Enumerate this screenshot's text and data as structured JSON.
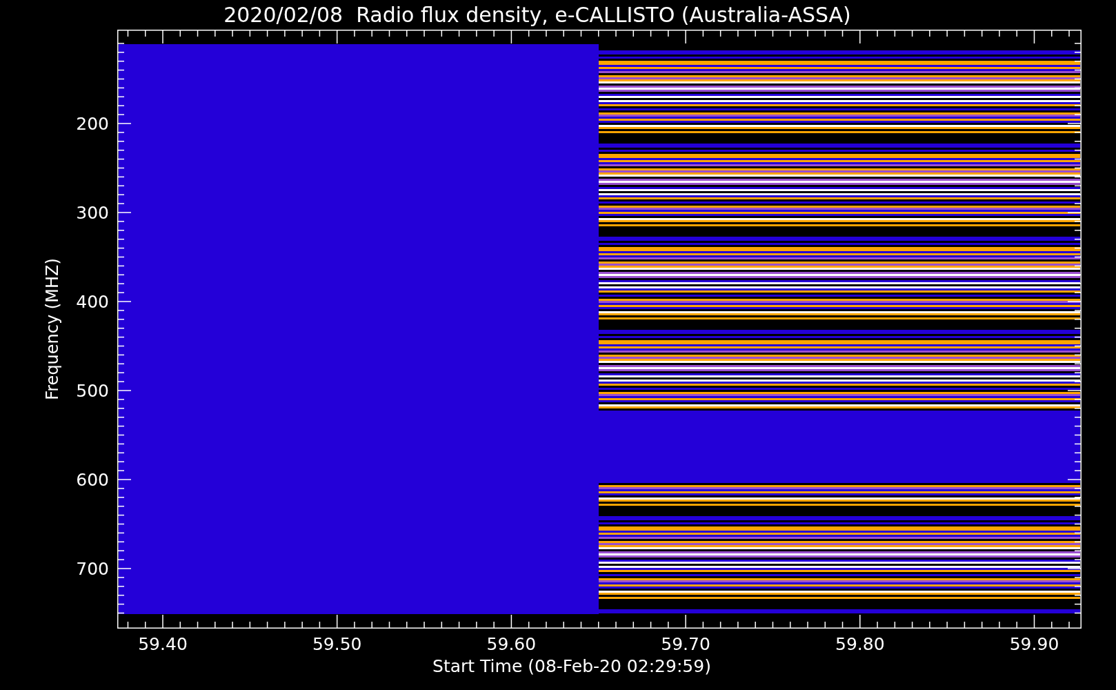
{
  "title": "2020/02/08  Radio flux density, e-CALLISTO (Australia-ASSA)",
  "y_axis": {
    "label": "Frequency (MHZ)",
    "ticks": [
      "200",
      "300",
      "400",
      "500",
      "600",
      "700"
    ]
  },
  "x_axis": {
    "label": "Start Time (08-Feb-20 02:29:59)",
    "ticks": [
      "59.40",
      "59.50",
      "59.60",
      "59.70",
      "59.80",
      "59.90"
    ]
  }
}
